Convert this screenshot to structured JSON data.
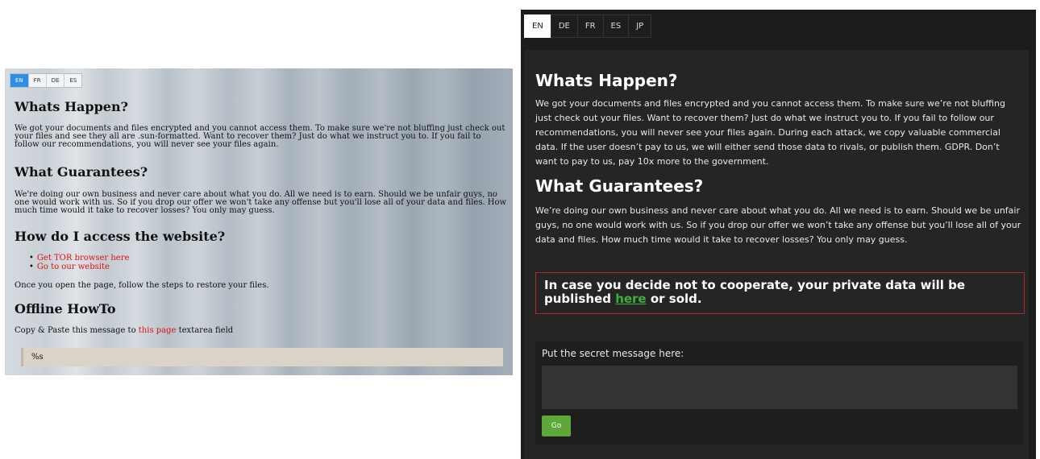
{
  "left": {
    "langs": [
      "EN",
      "FR",
      "DE",
      "ES"
    ],
    "h1": "Whats Happen?",
    "p1": "We got your documents and files encrypted and you cannot access them. To make sure we're not bluffing just check out your files and see they all are .sun-formatted. Want to recover them? Just do what we instruct you to. If you fail to follow our recommendations, you will never see your files again.",
    "h2": "What Guarantees?",
    "p2": "We're doing our own business and never care about what you do. All we need is to earn. Should we be unfair guys, no one would work with us. So if you drop our offer we won't take any offense but you'll lose all of your data and files. How much time would it take to recover losses? You only may guess.",
    "h3": "How do I access the website?",
    "links": [
      "Get TOR browser here",
      "Go to our website"
    ],
    "p3": "Once you open the page, follow the steps to restore your files.",
    "h4": "Offline HowTo",
    "p4_prefix": "Copy & Paste this message to ",
    "p4_link": "this page",
    "p4_suffix": " textarea field",
    "message": "%s"
  },
  "right": {
    "langs": [
      "EN",
      "DE",
      "FR",
      "ES",
      "JP"
    ],
    "h1": "Whats Happen?",
    "p1": "We got your documents and files encrypted and you cannot access them. To make sure we’re not bluffing just check out your files. Want to recover them? Just do what we instruct you to. If you fail to follow our recommendations, you will never see your files again. During each attack, we copy valuable commercial data. If the user doesn’t pay to us, we will either send those data to rivals, or publish them. GDPR. Don’t want to pay to us, pay 10x more to the government.",
    "h2": "What Guarantees?",
    "p2": "We’re doing our own business and never care about what you do. All we need is to earn. Should we be unfair guys, no one would work with us. So if you drop our offer we won’t take any offense but you’ll lose all of your data and files. How much time would it take to recover losses? You only may guess.",
    "warn_prefix": "In case you decide not to cooperate, your private data will be published ",
    "warn_link": "here",
    "warn_suffix": " or sold.",
    "form_label": "Put the secret message here:",
    "button_label": "Go"
  }
}
